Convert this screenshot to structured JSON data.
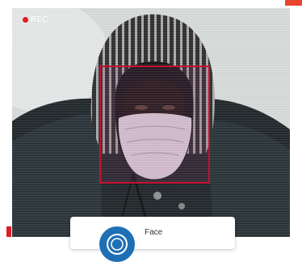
{
  "overlay": {
    "rec_label": "REC",
    "accent_color": "#e31b23",
    "detection_box_color": "#c8102e"
  },
  "card": {
    "label": "Face",
    "icon": "face-scan-icon"
  }
}
